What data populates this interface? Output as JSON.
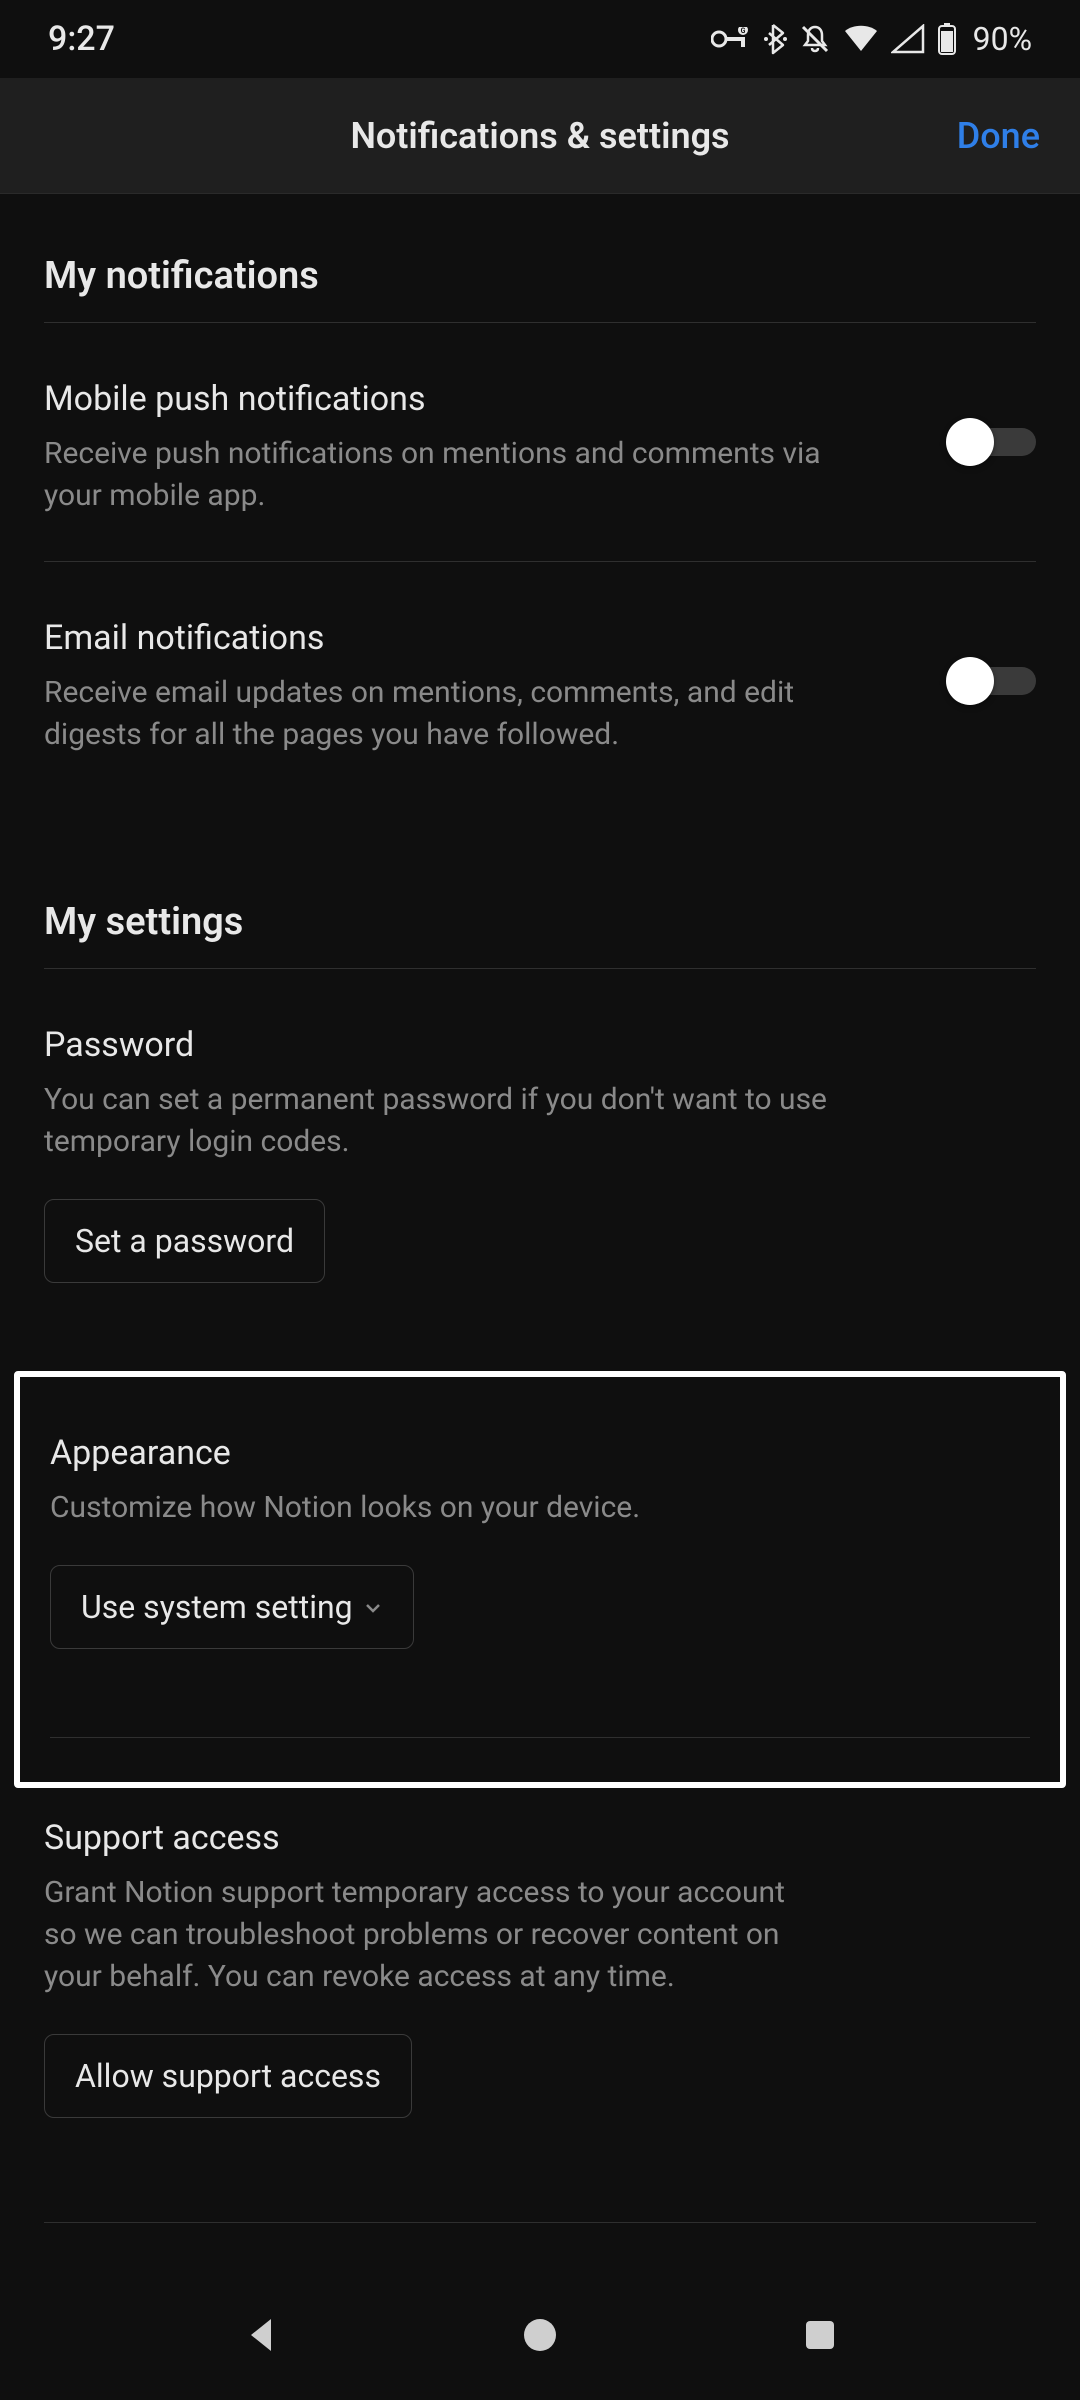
{
  "status_bar": {
    "time": "9:27",
    "battery_text": "90%"
  },
  "header": {
    "title": "Notifications & settings",
    "done": "Done"
  },
  "sections": {
    "notifications": {
      "title": "My notifications",
      "mobile_push": {
        "title": "Mobile push notifications",
        "desc": "Receive push notifications on mentions and comments via your mobile app."
      },
      "email": {
        "title": "Email notifications",
        "desc": "Receive email updates on mentions, comments, and edit digests for all the pages you have followed."
      }
    },
    "settings": {
      "title": "My settings",
      "password": {
        "title": "Password",
        "desc": "You can set a permanent password if you don't want to use temporary login codes.",
        "button": "Set a password"
      },
      "appearance": {
        "title": "Appearance",
        "desc": "Customize how Notion looks on your device.",
        "button": "Use system setting"
      },
      "support": {
        "title": "Support access",
        "desc": "Grant Notion support temporary access to your account so we can troubleshoot problems or recover content on your behalf. You can revoke access at any time.",
        "button": "Allow support access"
      }
    }
  }
}
